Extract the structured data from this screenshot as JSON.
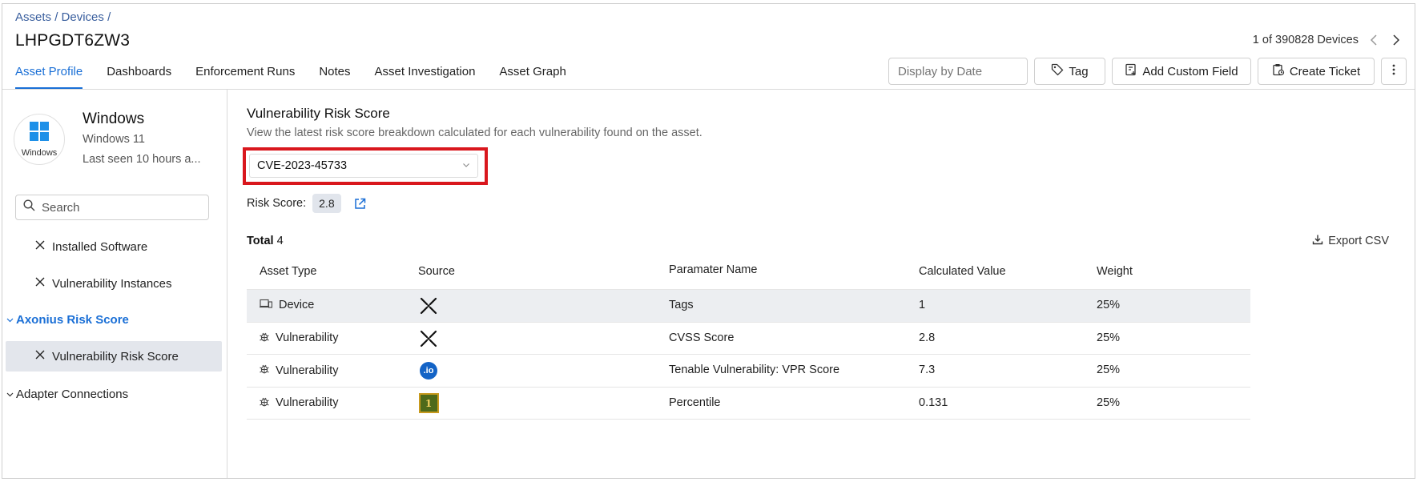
{
  "breadcrumb": [
    "Assets",
    "Devices"
  ],
  "page_title": "LHPGDT6ZW3",
  "pager": {
    "text": "1 of 390828 Devices"
  },
  "tabs": [
    "Asset Profile",
    "Dashboards",
    "Enforcement Runs",
    "Notes",
    "Asset Investigation",
    "Asset Graph"
  ],
  "active_tab": "Asset Profile",
  "toolbar": {
    "date_placeholder": "Display by Date",
    "tag_label": "Tag",
    "custom_field_label": "Add Custom Field",
    "ticket_label": "Create Ticket"
  },
  "os": {
    "logo_caption": "Windows",
    "name": "Windows",
    "version": "Windows 11",
    "last_seen": "Last seen 10 hours a..."
  },
  "sidebar": {
    "search_placeholder": "Search",
    "items": [
      {
        "label": "Installed Software"
      },
      {
        "label": "Vulnerability Instances"
      }
    ],
    "group_risk": "Axonius Risk Score",
    "selected_item": "Vulnerability Risk Score",
    "group_adapters": "Adapter Connections"
  },
  "main": {
    "title": "Vulnerability Risk Score",
    "description": "View the latest risk score breakdown calculated for each vulnerability found on the asset.",
    "selected_cve": "CVE-2023-45733",
    "risk_score_label": "Risk Score:",
    "risk_score_value": "2.8",
    "total_label": "Total",
    "total_count": "4",
    "export_label": "Export CSV"
  },
  "table": {
    "headers": [
      "Asset Type",
      "Source",
      "Paramater Name",
      "Calculated Value",
      "Weight"
    ],
    "rows": [
      {
        "asset_type": "Device",
        "source_icon": "axonius-logo",
        "parameter": "Tags",
        "value": "1",
        "weight": "25%"
      },
      {
        "asset_type": "Vulnerability",
        "source_icon": "axonius-logo",
        "parameter": "CVSS Score",
        "value": "2.8",
        "weight": "25%"
      },
      {
        "asset_type": "Vulnerability",
        "source_icon": "tenable-io-logo",
        "parameter": "Tenable Vulnerability: VPR Score",
        "value": "7.3",
        "weight": "25%"
      },
      {
        "asset_type": "Vulnerability",
        "source_icon": "percentile-logo",
        "parameter": "Percentile",
        "value": "0.131",
        "weight": "25%"
      }
    ]
  },
  "source_logo_text": {
    "tenable": ".io",
    "percentile": "1"
  },
  "colors": {
    "accent": "#1a6fd6",
    "highlight_border": "#d9171d",
    "selected_bg": "#e3e6ec"
  }
}
